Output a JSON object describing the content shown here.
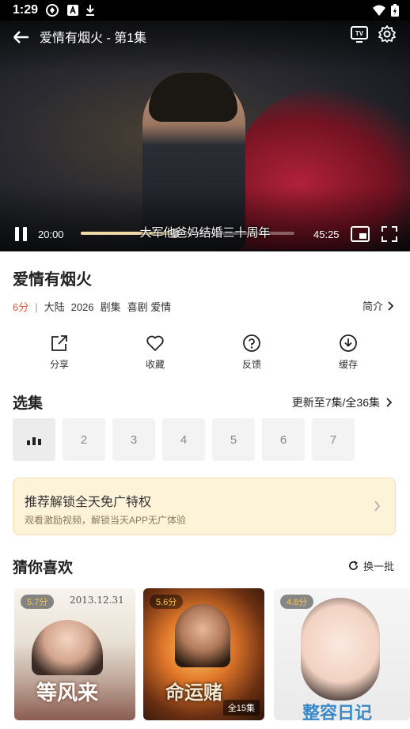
{
  "status_bar": {
    "time": "1:29"
  },
  "player": {
    "title": "爱情有烟火 - 第1集",
    "current_time": "20:00",
    "duration": "45:25",
    "subtitle": "大军他爸妈结婚三十周年",
    "progress": 0.44
  },
  "show": {
    "title": "爱情有烟火",
    "score": "6分",
    "separator": "|",
    "region": "大陆",
    "year": "2026",
    "category": "剧集",
    "genres": "喜剧 爱情",
    "intro_label": "简介"
  },
  "actions": [
    {
      "label": "分享",
      "icon": "share-icon"
    },
    {
      "label": "收藏",
      "icon": "heart-icon"
    },
    {
      "label": "反馈",
      "icon": "help-circle-icon"
    },
    {
      "label": "缓存",
      "icon": "download-circle-icon"
    }
  ],
  "episodes": {
    "section_title": "选集",
    "update_text": "更新至7集/全36集",
    "items": [
      "1",
      "2",
      "3",
      "4",
      "5",
      "6",
      "7"
    ],
    "active_index": 0
  },
  "promo": {
    "title": "推荐解锁全天免广特权",
    "subtitle": "观看激励视频，解锁当天APP无广体验"
  },
  "recommend": {
    "section_title": "猜你喜欢",
    "refresh_label": "换一批",
    "cards": [
      {
        "rating": "5.7分",
        "badge": ""
      },
      {
        "rating": "5.6分",
        "badge": "全15集"
      },
      {
        "rating": "4.8分",
        "badge": ""
      }
    ]
  },
  "colors": {
    "accent_score": "#e5533a",
    "promo_bg": "#fdf3d9",
    "progress_fill": "#f0d9a6"
  }
}
